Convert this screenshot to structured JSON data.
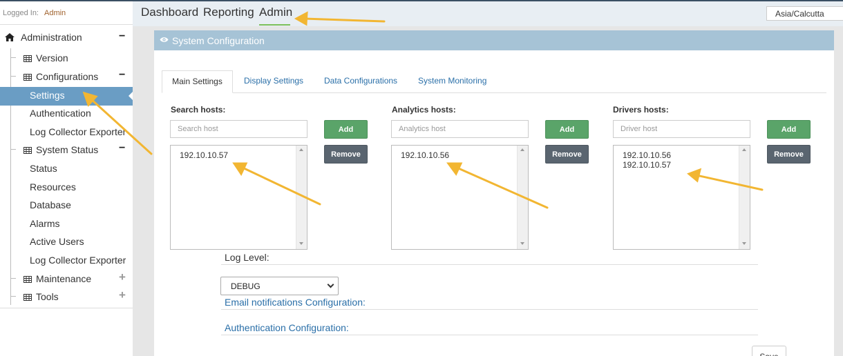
{
  "sidebar": {
    "logged_in_label": "Logged In:",
    "logged_in_user": "Admin",
    "items": [
      {
        "label": "Administration",
        "toggle": "−"
      },
      {
        "label": "Version"
      },
      {
        "label": "Configurations",
        "toggle": "−"
      },
      {
        "label": "Settings",
        "active": true
      },
      {
        "label": "Authentication"
      },
      {
        "label": "Log Collector Exporter"
      },
      {
        "label": "System Status",
        "toggle": "−"
      },
      {
        "label": "Status"
      },
      {
        "label": "Resources"
      },
      {
        "label": "Database"
      },
      {
        "label": "Alarms"
      },
      {
        "label": "Active Users"
      },
      {
        "label": "Log Collector Exporter"
      },
      {
        "label": "Maintenance",
        "toggle": "+"
      },
      {
        "label": "Tools",
        "toggle": "+"
      }
    ]
  },
  "topnav": {
    "items": [
      "Dashboard",
      "Reporting",
      "Admin"
    ],
    "active": "Admin",
    "timezone": "Asia/Calcutta"
  },
  "panel": {
    "title": "System Configuration"
  },
  "tabs": [
    "Main Settings",
    "Display Settings",
    "Data Configurations",
    "System Monitoring"
  ],
  "hosts": {
    "search": {
      "label": "Search hosts:",
      "placeholder": "Search host",
      "entries": [
        "192.10.10.57"
      ]
    },
    "analytics": {
      "label": "Analytics hosts:",
      "placeholder": "Analytics host",
      "entries": [
        "192.10.10.56"
      ]
    },
    "drivers": {
      "label": "Drivers hosts:",
      "placeholder": "Driver host",
      "entries": [
        "192.10.10.56",
        "192.10.10.57"
      ]
    }
  },
  "buttons": {
    "add": "Add",
    "remove": "Remove",
    "save": "Save"
  },
  "log_level": {
    "label": "Log Level:",
    "value": "DEBUG"
  },
  "sections": {
    "email": "Email notifications Configuration:",
    "auth": "Authentication Configuration:"
  },
  "colors": {
    "accent_blue": "#6a9dc4",
    "panel_header": "#a6c3d6",
    "add_green": "#5aa469",
    "remove_gray": "#5a6570",
    "link_blue": "#2a6fa8",
    "annotation_arrow": "#f2b632"
  }
}
